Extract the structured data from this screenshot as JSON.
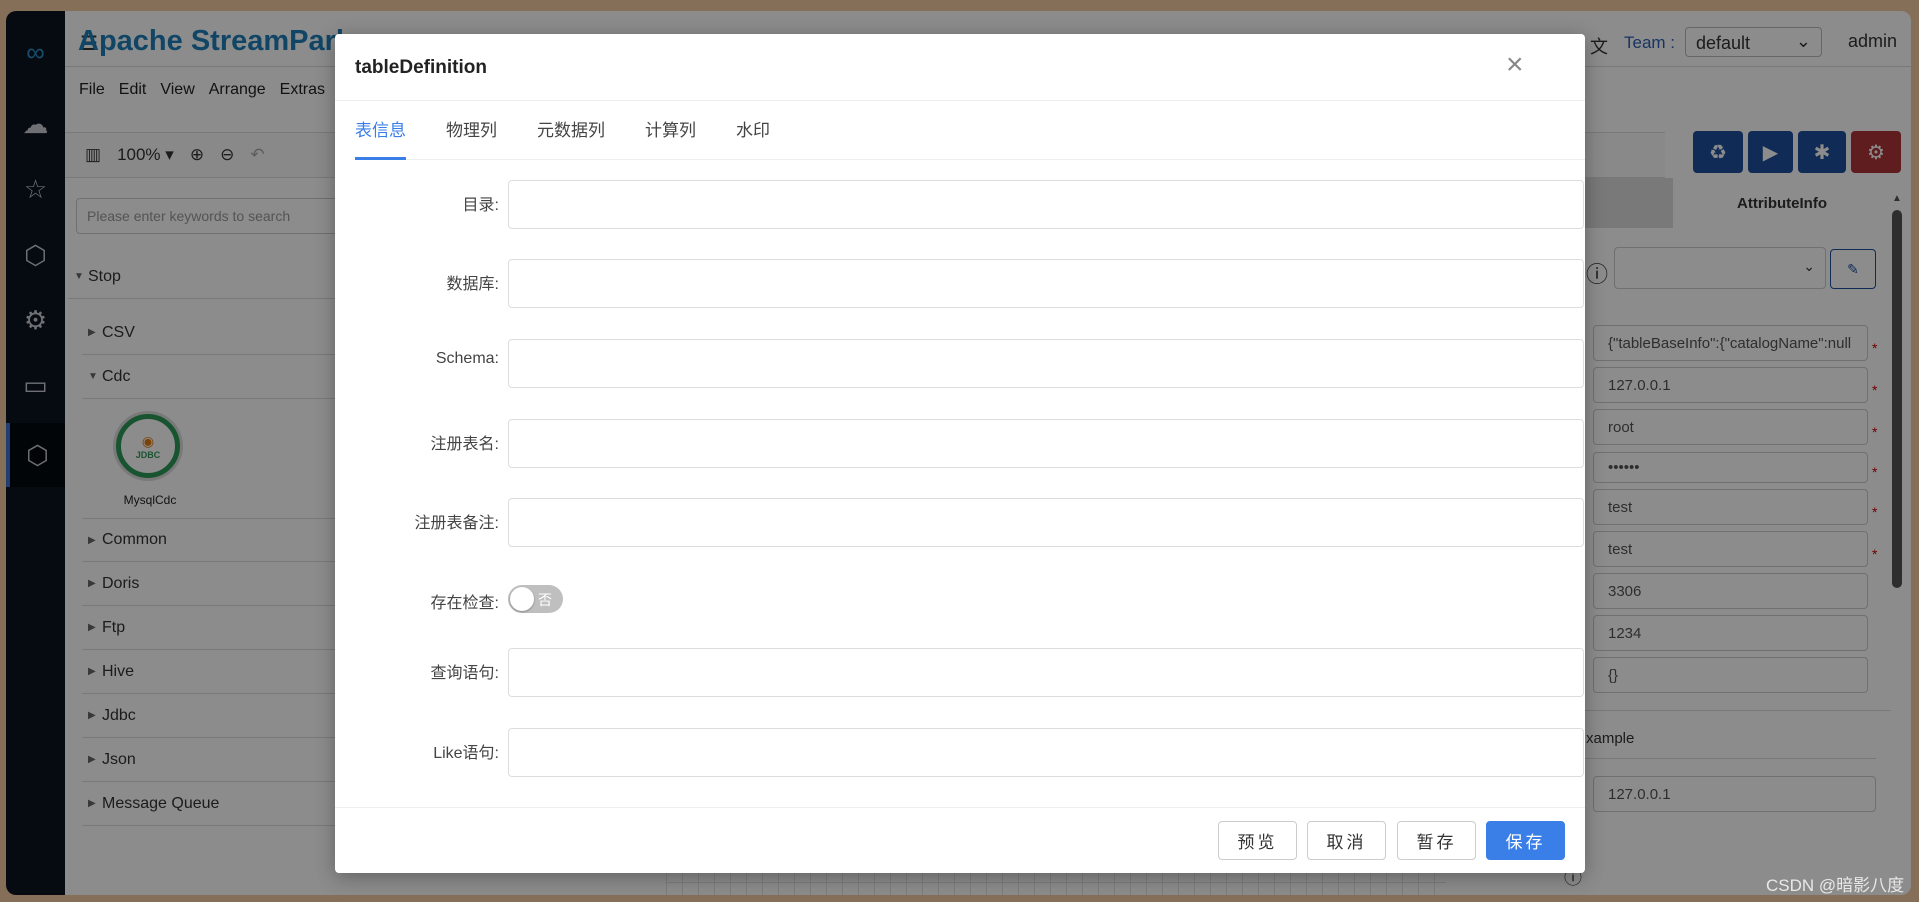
{
  "app": {
    "title": "Apache StreamPark",
    "menu": [
      "File",
      "Edit",
      "View",
      "Arrange",
      "Extras"
    ],
    "zoom": "100%"
  },
  "header": {
    "team_label": "Team :",
    "team_value": "default",
    "user": "admin"
  },
  "sidebar": {
    "icons": [
      "logo-icon",
      "stream-icon",
      "star-icon",
      "cubes-icon",
      "gear-icon",
      "monitor-icon",
      "cubes-icon"
    ]
  },
  "palette": {
    "search_placeholder": "Please enter keywords to search",
    "root": "Stop",
    "groups": [
      "CSV",
      "Cdc",
      "Common",
      "Doris",
      "Ftp",
      "Hive",
      "Jdbc",
      "Json",
      "Message Queue"
    ],
    "cdc_item": "MysqlCdc",
    "cdc_badge": "JDBC"
  },
  "right_panel": {
    "tab_active": "AttributeInfo",
    "fields": [
      "{\"tableBaseInfo\":{\"catalogName\":null",
      "127.0.0.1",
      "root",
      "••••••",
      "test",
      "test",
      "3306",
      "1234",
      "{}"
    ],
    "required_count": 6,
    "example_label": "xample",
    "example_value": "127.0.0.1",
    "colors": {
      "blue": "#1e4f9c",
      "red": "#b0353a"
    }
  },
  "modal": {
    "title": "tableDefinition",
    "tabs": [
      "表信息",
      "物理列",
      "元数据列",
      "计算列",
      "水印"
    ],
    "active_tab": 0,
    "fields": [
      {
        "label": "目录:",
        "value": ""
      },
      {
        "label": "数据库:",
        "value": ""
      },
      {
        "label": "Schema:",
        "value": ""
      },
      {
        "label": "注册表名:",
        "value": ""
      },
      {
        "label": "注册表备注:",
        "value": ""
      }
    ],
    "exist_check": {
      "label": "存在检查:",
      "state": "否",
      "on": false
    },
    "query": {
      "label": "查询语句:",
      "value": ""
    },
    "like": {
      "label": "Like语句:",
      "value": ""
    },
    "buttons": {
      "preview": "预览",
      "cancel": "取消",
      "draft": "暂存",
      "save": "保存"
    },
    "accent": "#3a7ee8"
  },
  "watermark": "CSDN @暗影八度"
}
